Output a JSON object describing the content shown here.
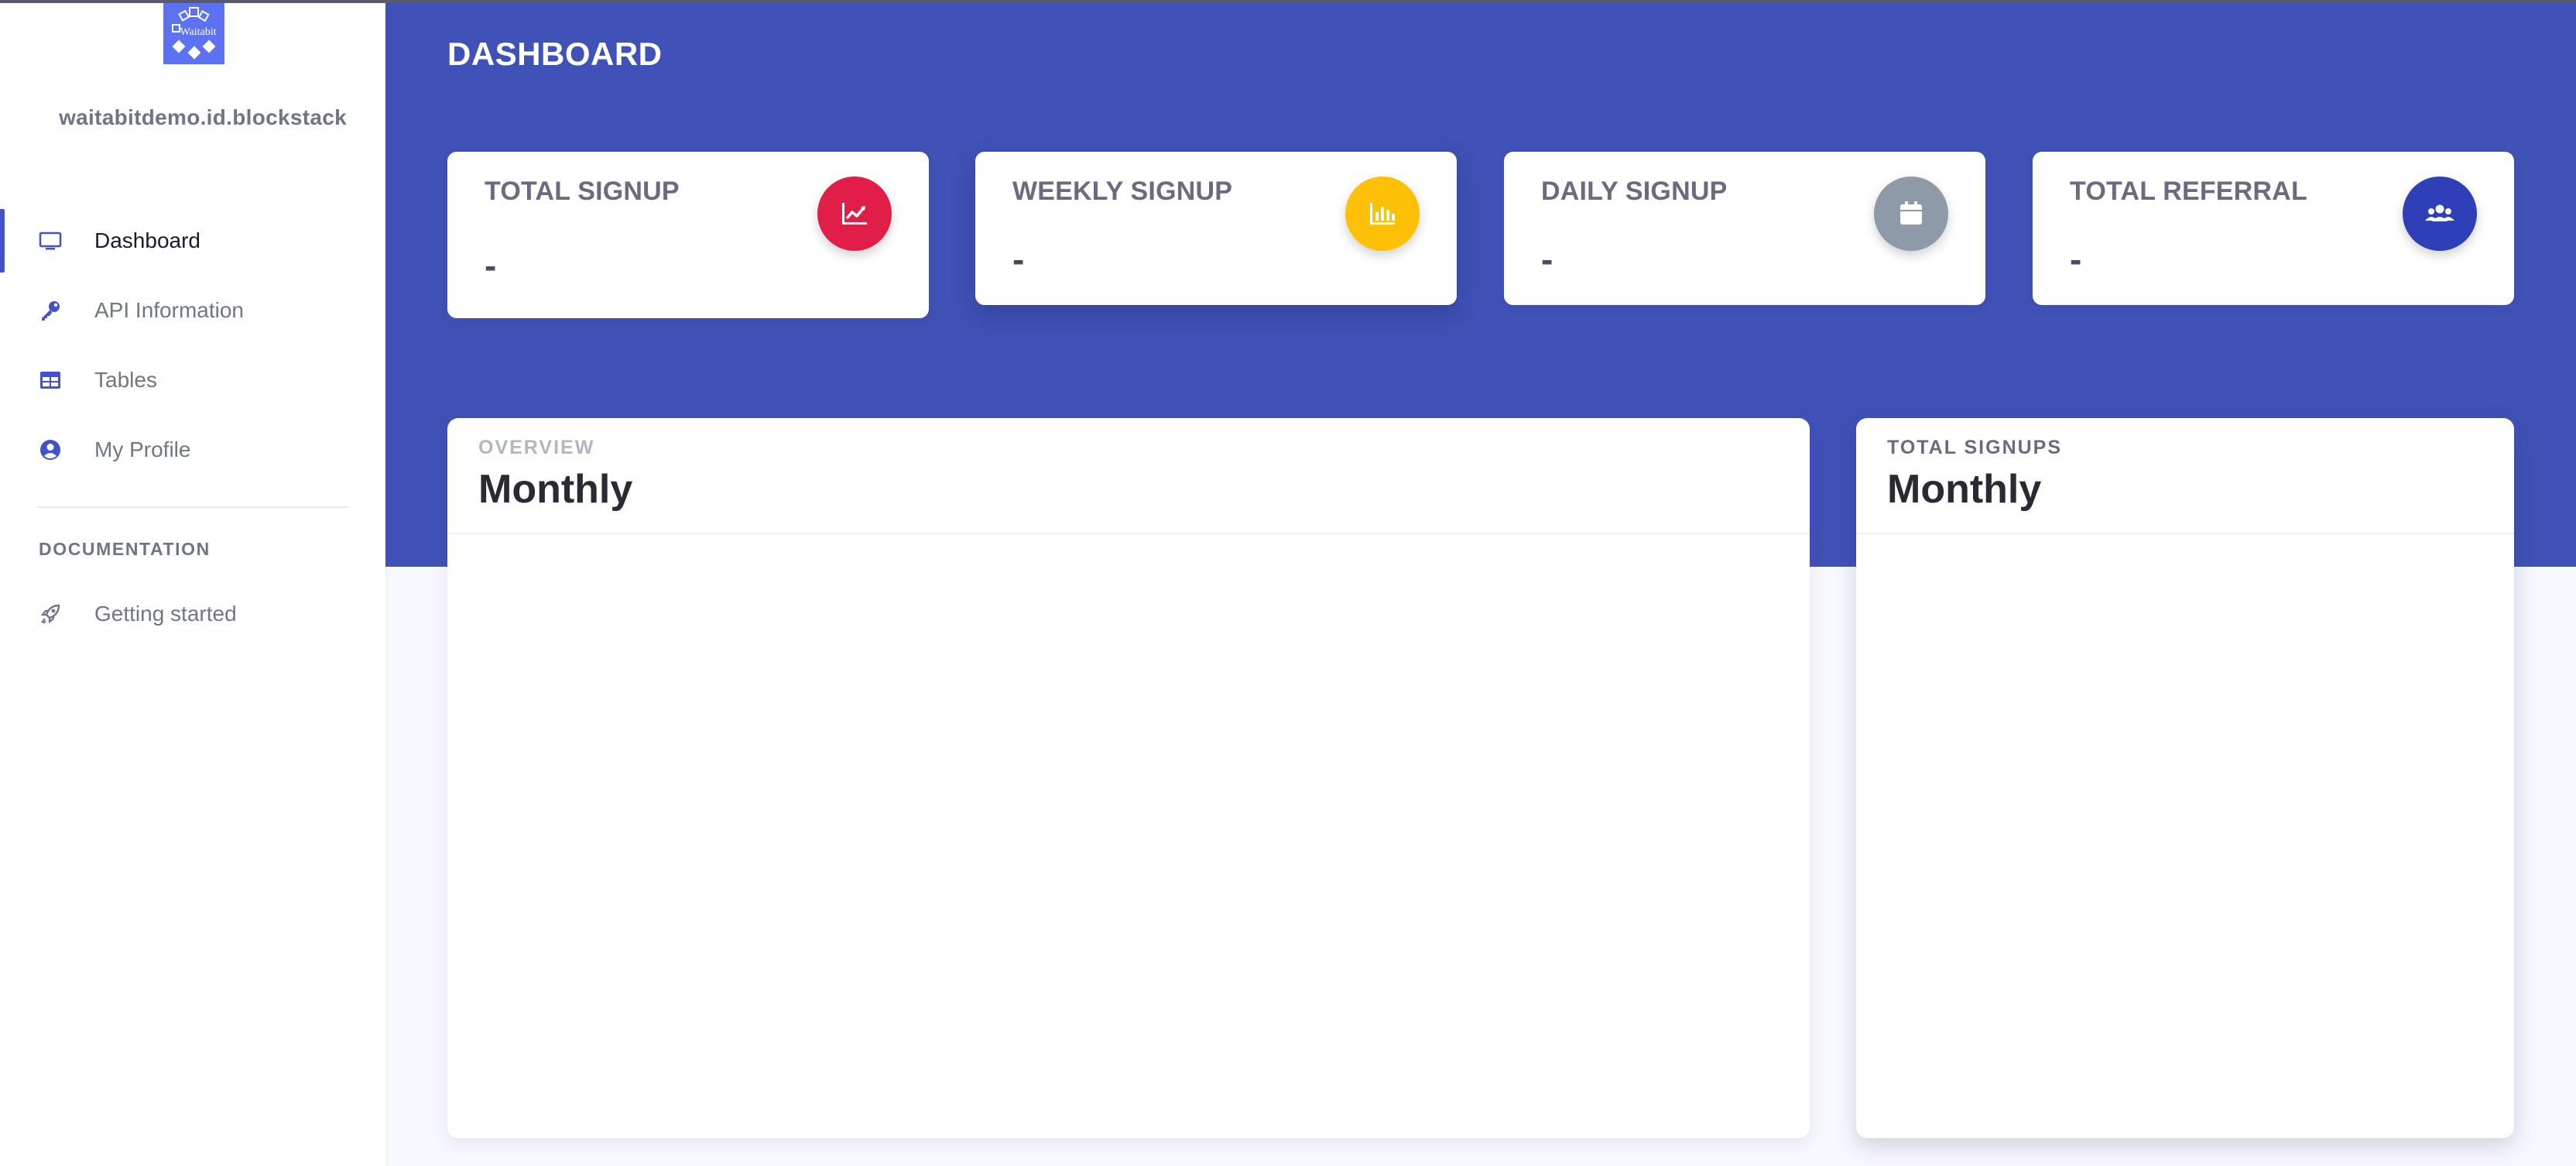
{
  "app": {
    "logo_text": "Waitabit",
    "user_name": "waitabitdemo.id.blockstack"
  },
  "sidebar": {
    "items": [
      {
        "label": "Dashboard",
        "icon": "monitor-icon",
        "active": true
      },
      {
        "label": "API Information",
        "icon": "key-icon",
        "active": false
      },
      {
        "label": "Tables",
        "icon": "table-icon",
        "active": false
      },
      {
        "label": "My Profile",
        "icon": "user-circle-icon",
        "active": false
      }
    ],
    "documentation_heading": "DOCUMENTATION",
    "doc_items": [
      {
        "label": "Getting started",
        "icon": "rocket-icon"
      }
    ]
  },
  "header": {
    "title": "DASHBOARD",
    "band_color": "#4052b7"
  },
  "stats": [
    {
      "title": "TOTAL SIGNUP",
      "value": "-",
      "icon": "chart-line-icon",
      "color": "#e01e48"
    },
    {
      "title": "WEEKLY SIGNUP",
      "value": "-",
      "icon": "chart-bar-icon",
      "color": "#ffc107"
    },
    {
      "title": "DAILY SIGNUP",
      "value": "-",
      "icon": "calendar-icon",
      "color": "#8e9aa8"
    },
    {
      "title": "TOTAL REFERRAL",
      "value": "-",
      "icon": "users-icon",
      "color": "#2f3fb8"
    }
  ],
  "panels": [
    {
      "overline": "OVERVIEW",
      "title": "Monthly"
    },
    {
      "overline": "TOTAL SIGNUPS",
      "title": "Monthly"
    }
  ]
}
